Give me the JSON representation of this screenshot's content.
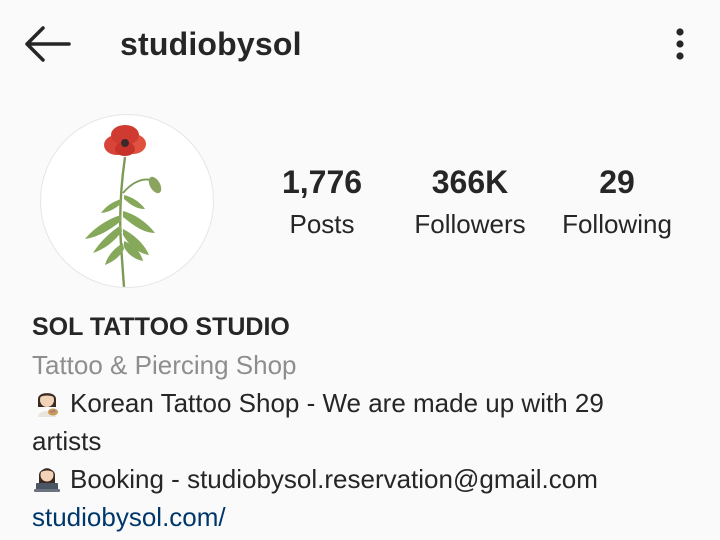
{
  "header": {
    "username": "studiobysol",
    "back_icon": "arrow-left-icon",
    "more_icon": "more-vertical-icon"
  },
  "profile": {
    "avatar_icon": "poppy-flower-illustration",
    "stats": [
      {
        "value": "1,776",
        "label": "Posts"
      },
      {
        "value": "366K",
        "label": "Followers"
      },
      {
        "value": "29",
        "label": "Following"
      }
    ]
  },
  "bio": {
    "name": "SOL TATTOO STUDIO",
    "category": "Tattoo & Piercing Shop",
    "line1": "Korean Tattoo Shop - We are made up with 29",
    "line1_cont": "artists",
    "line2": "Booking - studiobysol.reservation@gmail.com",
    "link": "studiobysol.com/",
    "emoji1": "woman-artist-emoji",
    "emoji2": "woman-technologist-emoji"
  },
  "colors": {
    "background": "#fafafa",
    "text": "#262626",
    "secondary": "#8e8e8e",
    "link": "#00376b",
    "poppy": "#d9443a"
  }
}
